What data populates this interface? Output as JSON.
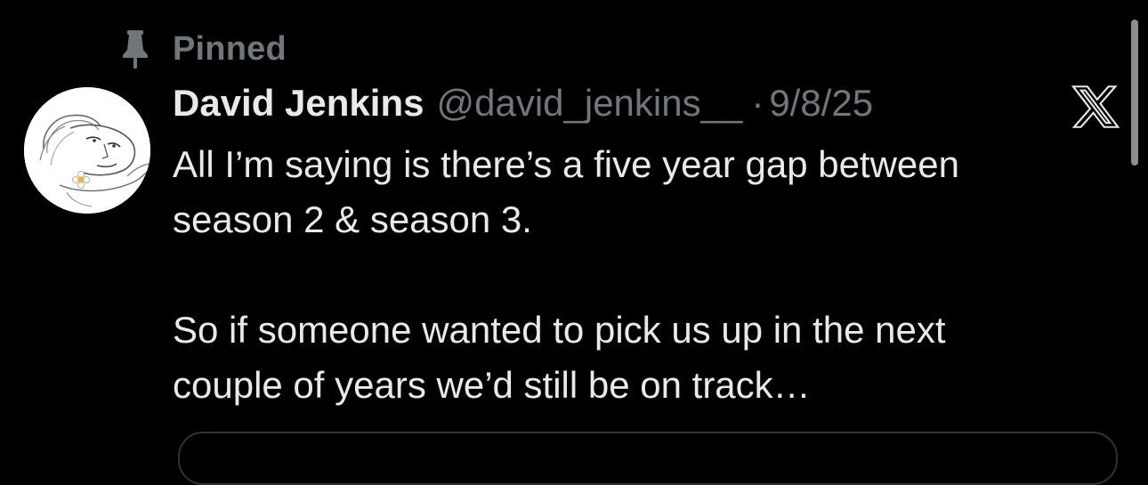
{
  "pinned": {
    "label": "Pinned",
    "icon": "pin-icon"
  },
  "author": {
    "display_name": "David Jenkins",
    "handle": "@david_jenkins__",
    "separator": "·",
    "date": "9/8/25",
    "avatar_icon": "avatar-sketch"
  },
  "post": {
    "paragraphs": [
      "All I’m saying is there’s a five year gap between\nseason 2 & season 3.",
      "So if someone wanted to pick us up in the next\ncouple of years we’d still be on track…"
    ]
  },
  "brand": {
    "icon": "x-logo-icon"
  },
  "colors": {
    "background": "#000000",
    "primary_text": "#e7e9ea",
    "secondary_text": "#71767b"
  }
}
